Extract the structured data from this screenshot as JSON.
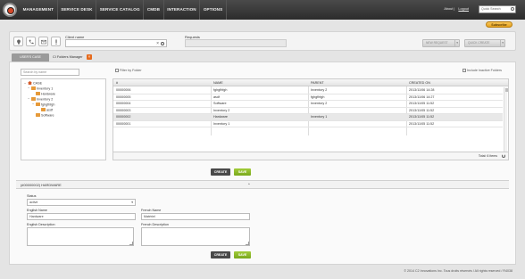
{
  "nav": {
    "items": [
      "MANAGEMENT",
      "SERVICE DESK",
      "SERVICE CATALOG",
      "CMDB",
      "INTERACTION",
      "OPTIONS"
    ],
    "about": "About |",
    "logout": "Logout",
    "quick_search_placeholder": "Quick Search"
  },
  "subscribe_label": "Subscribe",
  "filter": {
    "icons": [
      "lightbulb-icon",
      "phone-icon",
      "email-icon",
      "alert-icon"
    ],
    "client_label": "Client name",
    "client_clear": "×",
    "requests_label": "Requests",
    "new_request_label": "NEW REQUEST",
    "quick_create_label": "QUICK CREATE"
  },
  "tabs": {
    "active": "USER'S CASE",
    "manager": "CI Folders Manager",
    "close": "×"
  },
  "tree": {
    "search_placeholder": "Search by name",
    "nodes": [
      {
        "label": "CASE",
        "kind": "root",
        "expander": "−"
      },
      {
        "label": "Inventory 1",
        "kind": "folder",
        "expander": "−"
      },
      {
        "label": "Hardware",
        "kind": "folder",
        "expander": ""
      },
      {
        "label": "Inventory 2",
        "kind": "folder",
        "expander": "−"
      },
      {
        "label": "fghgfhfgh",
        "kind": "folder",
        "expander": "−"
      },
      {
        "label": "asdf",
        "kind": "folder",
        "expander": ""
      },
      {
        "label": "Software",
        "kind": "folder",
        "expander": ""
      }
    ]
  },
  "grid": {
    "filter_by_folder": "Filter by Folder",
    "include_inactive": "Include Inactive Folders",
    "columns": [
      "#",
      "NAME",
      "PARENT",
      "CREATED ON"
    ],
    "rows": [
      {
        "id": "00000006",
        "name": "fghgfhfgh",
        "parent": "Inventory 2",
        "created": "2013/11/06 14:28",
        "selected": false
      },
      {
        "id": "00000005",
        "name": "asdf",
        "parent": "fghgfhfgh",
        "created": "2013/11/06 14:27",
        "selected": false
      },
      {
        "id": "00000004",
        "name": "Software",
        "parent": "Inventory 2",
        "created": "2013/11/05 11:52",
        "selected": false
      },
      {
        "id": "00000003",
        "name": "Inventory 2",
        "parent": "",
        "created": "2013/11/05 11:52",
        "selected": false
      },
      {
        "id": "00000002",
        "name": "Hardware",
        "parent": "Inventory 1",
        "created": "2013/11/05 11:52",
        "selected": true
      },
      {
        "id": "00000001",
        "name": "Inventory 1",
        "parent": "",
        "created": "2013/11/05 11:52",
        "selected": false
      }
    ],
    "total": "Total: 6 items"
  },
  "buttons": {
    "create": "CREATE",
    "save": "SAVE"
  },
  "detail": {
    "title": "(#00000002) HARDWARE",
    "status_label": "Status",
    "status_value": "active",
    "english_name_label": "English Name",
    "english_name_value": "Hardware",
    "french_name_label": "French Name",
    "french_name_value": "Matériel",
    "english_desc_label": "English Description",
    "french_desc_label": "French Description"
  },
  "footer": "© 2014 C2 Innovations Inc. Tous droits réservés / All rights reserved / R4038"
}
